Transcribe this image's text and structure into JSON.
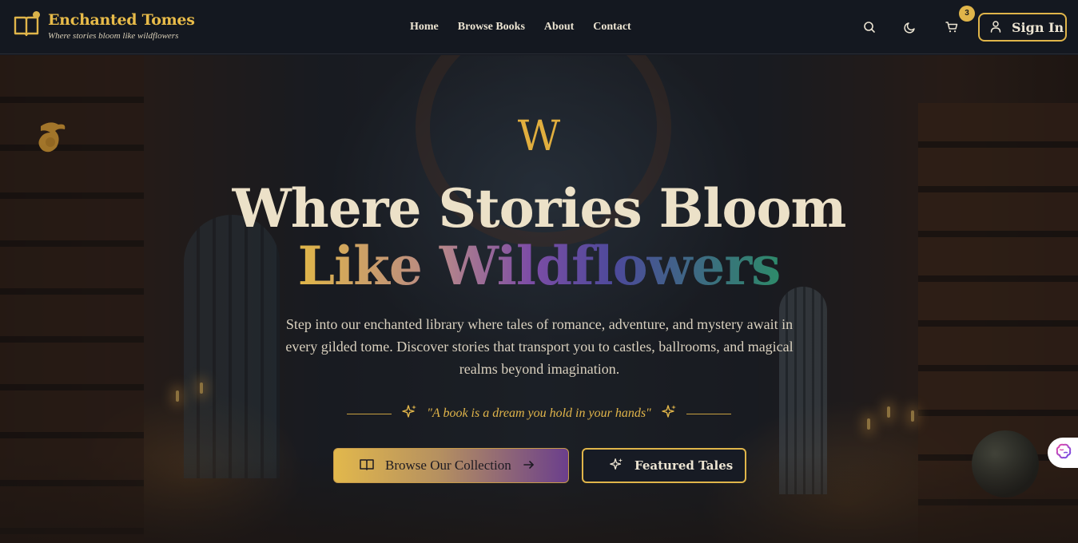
{
  "header": {
    "brand_title": "Enchanted Tomes",
    "brand_tagline": "Where stories bloom like wildflowers",
    "nav": [
      {
        "label": "Home"
      },
      {
        "label": "Browse Books"
      },
      {
        "label": "About"
      },
      {
        "label": "Contact"
      }
    ],
    "cart_count": "3",
    "signin_label": "Sign In",
    "icons": [
      "book-open-icon",
      "search-icon",
      "moon-icon",
      "cart-icon",
      "user-icon"
    ]
  },
  "hero": {
    "monogram": "W",
    "title_line1": "Where Stories Bloom",
    "title_line2": "Like Wildflowers",
    "description": "Step into our enchanted library where tales of romance, adventure, and mystery await in every gilded tome. Discover stories that transport you to castles, ballrooms, and magical realms beyond imagination.",
    "quote": "\"A book is a dream you hold in your hands\"",
    "primary_button": "Browse Our Collection",
    "secondary_button": "Featured Tales"
  },
  "colors": {
    "accent_gold": "#e0b54a",
    "background": "#141820",
    "gradient_purple": "#6b3f8c",
    "gradient_green": "#2e8a6a"
  }
}
